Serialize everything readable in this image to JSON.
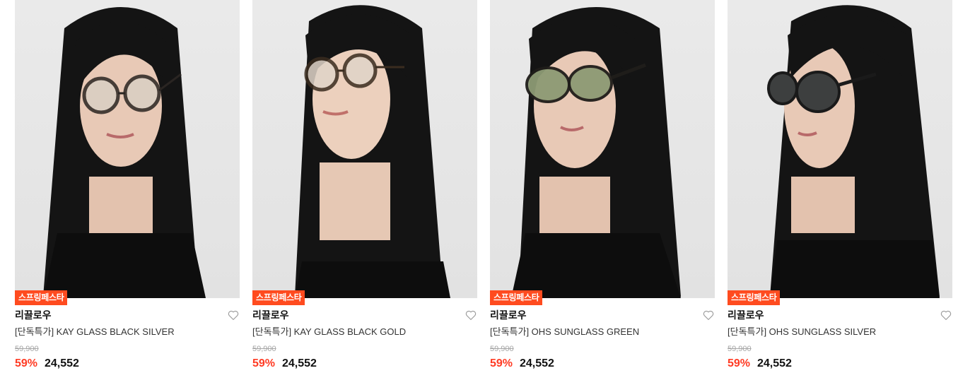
{
  "products": [
    {
      "badge": "스프링페스타",
      "brand": "리끌로우",
      "name": "[단독특가] KAY GLASS BLACK SILVER",
      "original_price": "59,900",
      "discount": "59%",
      "price": "24,552",
      "lens_color": "#d9cfc4",
      "frame_color": "#2a2522"
    },
    {
      "badge": "스프링페스타",
      "brand": "리끌로우",
      "name": "[단독특가] KAY GLASS BLACK GOLD",
      "original_price": "59,900",
      "discount": "59%",
      "price": "24,552",
      "lens_color": "#e0d4c8",
      "frame_color": "#3a2c1f"
    },
    {
      "badge": "스프링페스타",
      "brand": "리끌로우",
      "name": "[단독특가] OHS SUNGLASS GREEN",
      "original_price": "59,900",
      "discount": "59%",
      "price": "24,552",
      "lens_color": "#8d9a74",
      "frame_color": "#1f1d1a"
    },
    {
      "badge": "스프링페스타",
      "brand": "리끌로우",
      "name": "[단독특가] OHS SUNGLASS SILVER",
      "original_price": "59,900",
      "discount": "59%",
      "price": "24,552",
      "lens_color": "#3d3f3f",
      "frame_color": "#1a1a1a"
    }
  ],
  "icons": {
    "wishlist": "heart-outline-icon"
  },
  "colors": {
    "badge_bg": "#ff4b1f",
    "discount": "#ff3b24"
  }
}
